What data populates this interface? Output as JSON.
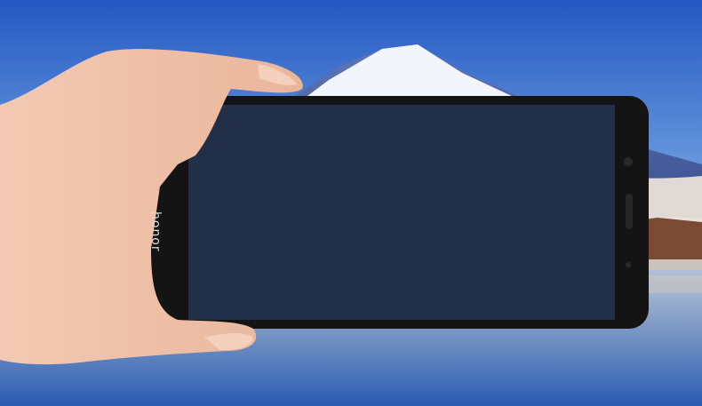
{
  "scene": {
    "description_colors": {
      "sky_top": "#2558c4",
      "sky_bottom": "#b9d3ee",
      "water": "#2f5ea8",
      "phone_body": "#151515"
    }
  },
  "phone": {
    "brand_text": "honor"
  }
}
